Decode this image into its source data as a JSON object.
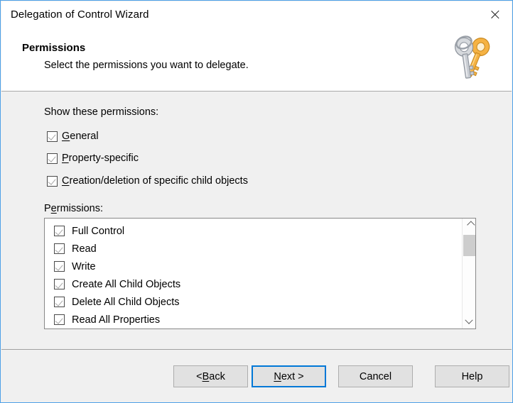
{
  "window": {
    "title": "Delegation of Control Wizard",
    "close_label": "Close",
    "accent_blue": "#4ea1e8"
  },
  "header": {
    "title": "Permissions",
    "subtitle": "Select the permissions you want to delegate.",
    "icon": "keys-icon"
  },
  "body": {
    "show_permissions_label": "Show these permissions:",
    "permissions_label_pre": "P",
    "permissions_label_acc": "e",
    "permissions_label_post": "rmissions:",
    "show_options": [
      {
        "pre": "",
        "acc": "G",
        "post": "eneral",
        "checked": true
      },
      {
        "pre": "",
        "acc": "P",
        "post": "roperty-specific",
        "checked": true
      },
      {
        "pre": "",
        "acc": "C",
        "post": "reation/deletion of specific child objects",
        "checked": true
      }
    ],
    "permission_items": [
      {
        "label": "Full Control",
        "checked": true
      },
      {
        "label": "Read",
        "checked": true
      },
      {
        "label": "Write",
        "checked": true
      },
      {
        "label": "Create All Child Objects",
        "checked": true
      },
      {
        "label": "Delete All Child Objects",
        "checked": true
      },
      {
        "label": "Read All Properties",
        "checked": true
      },
      {
        "label": "",
        "checked": true
      }
    ],
    "scrollbar": {
      "up_arrow": "chevron-up-icon",
      "down_arrow": "chevron-down-icon"
    }
  },
  "footer": {
    "buttons": [
      {
        "pre": "< ",
        "acc": "B",
        "post": "ack",
        "focused": false,
        "name": "back-button"
      },
      {
        "pre": "",
        "acc": "N",
        "post": "ext >",
        "focused": true,
        "name": "next-button"
      },
      {
        "pre": "Cancel",
        "acc": "",
        "post": "",
        "focused": false,
        "name": "cancel-button"
      },
      {
        "pre": "Help",
        "acc": "",
        "post": "",
        "focused": false,
        "name": "help-button"
      }
    ]
  }
}
